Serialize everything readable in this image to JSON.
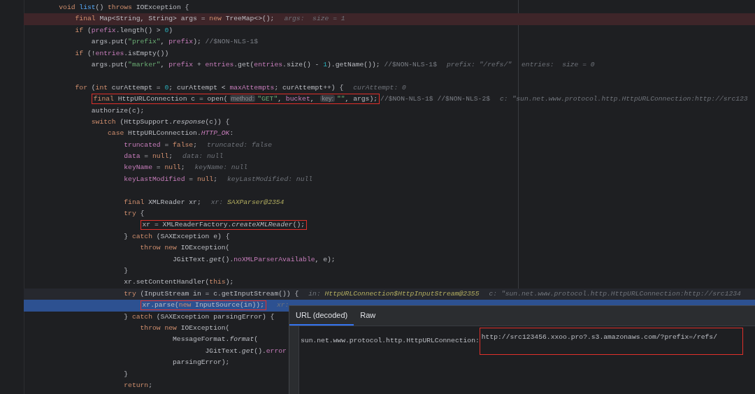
{
  "editor": {
    "lines": [
      {
        "kind": "code",
        "code": [
          {
            "framed": false,
            "tokens": [
              {
                "kind": "keyword",
                "text": "void"
              },
              {
                "kind": "method",
                "text": " list"
              },
              {
                "kind": "plain",
                "text": "() "
              },
              {
                "kind": "keyword",
                "text": "throws"
              },
              {
                "kind": "plain",
                "text": " IOException {"
              }
            ]
          }
        ],
        "children": [
          {
            "kind": "breakpoint",
            "code": [
              {
                "framed": false,
                "tokens": [
                  {
                    "kind": "keyword",
                    "text": "final"
                  },
                  {
                    "kind": "plain",
                    "text": " Map<String, String> args = "
                  },
                  {
                    "kind": "keyword",
                    "text": "new"
                  },
                  {
                    "kind": "plain",
                    "text": " TreeMap<>();"
                  }
                ]
              }
            ],
            "values": [
              {
                "name": "args:",
                "value": " size = 1",
                "kind": "text"
              }
            ]
          },
          {
            "kind": "code",
            "code": [
              {
                "framed": false,
                "tokens": [
                  {
                    "kind": "keyword",
                    "text": "if"
                  },
                  {
                    "kind": "plain",
                    "text": " ("
                  },
                  {
                    "kind": "field",
                    "text": "prefix"
                  },
                  {
                    "kind": "plain",
                    "text": ".length() > "
                  },
                  {
                    "kind": "number",
                    "text": "0"
                  },
                  {
                    "kind": "plain",
                    "text": ")"
                  }
                ]
              }
            ],
            "children": [
              {
                "kind": "code",
                "code": [
                  {
                    "framed": false,
                    "tokens": [
                      {
                        "kind": "plain",
                        "text": "args.put("
                      },
                      {
                        "kind": "string",
                        "text": "\"prefix\""
                      },
                      {
                        "kind": "plain",
                        "text": ", "
                      },
                      {
                        "kind": "field",
                        "text": "prefix"
                      },
                      {
                        "kind": "plain",
                        "text": "); "
                      },
                      {
                        "kind": "comment",
                        "text": "//$NON-NLS-1$"
                      }
                    ]
                  }
                ]
              }
            ]
          },
          {
            "kind": "code",
            "code": [
              {
                "framed": false,
                "tokens": [
                  {
                    "kind": "keyword",
                    "text": "if"
                  },
                  {
                    "kind": "plain",
                    "text": " (!"
                  },
                  {
                    "kind": "field",
                    "text": "entries"
                  },
                  {
                    "kind": "plain",
                    "text": ".isEmpty())"
                  }
                ]
              }
            ],
            "children": [
              {
                "kind": "code",
                "code": [
                  {
                    "framed": false,
                    "tokens": [
                      {
                        "kind": "plain",
                        "text": "args.put("
                      },
                      {
                        "kind": "string",
                        "text": "\"marker\""
                      },
                      {
                        "kind": "plain",
                        "text": ", "
                      },
                      {
                        "kind": "field",
                        "text": "prefix"
                      },
                      {
                        "kind": "plain",
                        "text": " + "
                      },
                      {
                        "kind": "field",
                        "text": "entries"
                      },
                      {
                        "kind": "plain",
                        "text": ".get("
                      },
                      {
                        "kind": "field",
                        "text": "entries"
                      },
                      {
                        "kind": "plain",
                        "text": ".size() - "
                      },
                      {
                        "kind": "number",
                        "text": "1"
                      },
                      {
                        "kind": "plain",
                        "text": ").getName()); "
                      },
                      {
                        "kind": "comment",
                        "text": "//$NON-NLS-1$"
                      }
                    ]
                  }
                ],
                "values": [
                  {
                    "name": "prefix:",
                    "value": "\"/refs/\"",
                    "kind": "text"
                  },
                  {
                    "name": "entries:",
                    "value": " size = 0",
                    "kind": "text"
                  }
                ]
              }
            ]
          },
          {
            "kind": "blank"
          },
          {
            "kind": "code",
            "code": [
              {
                "framed": false,
                "tokens": [
                  {
                    "kind": "keyword",
                    "text": "for"
                  },
                  {
                    "kind": "plain",
                    "text": " ("
                  },
                  {
                    "kind": "keyword",
                    "text": "int"
                  },
                  {
                    "kind": "plain",
                    "text": " curAttempt = "
                  },
                  {
                    "kind": "number",
                    "text": "0"
                  },
                  {
                    "kind": "plain",
                    "text": "; curAttempt < "
                  },
                  {
                    "kind": "field",
                    "text": "maxAttempts"
                  },
                  {
                    "kind": "plain",
                    "text": "; curAttempt++) {"
                  }
                ]
              }
            ],
            "values": [
              {
                "name": "curAttempt:",
                "value": "0",
                "kind": "text"
              }
            ],
            "children": [
              {
                "kind": "code",
                "code": [
                  {
                    "framed": true,
                    "tokens": [
                      {
                        "kind": "keyword",
                        "text": "final"
                      },
                      {
                        "kind": "plain",
                        "text": " HttpURLConnection c = open("
                      },
                      {
                        "kind": "hint",
                        "text": "method:"
                      },
                      {
                        "kind": "string",
                        "text": "\"GET\""
                      },
                      {
                        "kind": "plain",
                        "text": ", "
                      },
                      {
                        "kind": "field",
                        "text": "bucket"
                      },
                      {
                        "kind": "plain",
                        "text": ", "
                      },
                      {
                        "kind": "hint",
                        "text": "key:"
                      },
                      {
                        "kind": "string",
                        "text": "\"\""
                      },
                      {
                        "kind": "plain",
                        "text": ", args);"
                      }
                    ]
                  },
                  {
                    "framed": false,
                    "tokens": [
                      {
                        "kind": "comment",
                        "text": "//$NON-NLS-1$ //$NON-NLS-2$"
                      }
                    ]
                  }
                ],
                "values": [
                  {
                    "name": "c:",
                    "value": "\"sun.net.www.protocol.http.HttpURLConnection:http://src123",
                    "kind": "text"
                  }
                ]
              },
              {
                "kind": "code",
                "code": [
                  {
                    "framed": false,
                    "tokens": [
                      {
                        "kind": "plain",
                        "text": "authorize(c);"
                      }
                    ]
                  }
                ]
              },
              {
                "kind": "code",
                "code": [
                  {
                    "framed": false,
                    "tokens": [
                      {
                        "kind": "keyword",
                        "text": "switch"
                      },
                      {
                        "kind": "plain",
                        "text": " (HttpSupport."
                      },
                      {
                        "kind": "call",
                        "text": "response"
                      },
                      {
                        "kind": "plain",
                        "text": "(c)) {"
                      }
                    ]
                  }
                ],
                "children": [
                  {
                    "kind": "code",
                    "code": [
                      {
                        "framed": false,
                        "tokens": [
                          {
                            "kind": "keyword",
                            "text": "case"
                          },
                          {
                            "kind": "plain",
                            "text": " HttpURLConnection."
                          },
                          {
                            "kind": "constant",
                            "text": "HTTP_OK"
                          },
                          {
                            "kind": "plain",
                            "text": ":"
                          }
                        ]
                      }
                    ],
                    "children": [
                      {
                        "kind": "code",
                        "code": [
                          {
                            "framed": false,
                            "tokens": [
                              {
                                "kind": "field",
                                "text": "truncated"
                              },
                              {
                                "kind": "plain",
                                "text": " = "
                              },
                              {
                                "kind": "keyword",
                                "text": "false"
                              },
                              {
                                "kind": "plain",
                                "text": ";"
                              }
                            ]
                          }
                        ],
                        "values": [
                          {
                            "name": "truncated:",
                            "value": "false",
                            "kind": "text"
                          }
                        ]
                      },
                      {
                        "kind": "code",
                        "code": [
                          {
                            "framed": false,
                            "tokens": [
                              {
                                "kind": "field",
                                "text": "data"
                              },
                              {
                                "kind": "plain",
                                "text": " = "
                              },
                              {
                                "kind": "keyword",
                                "text": "null"
                              },
                              {
                                "kind": "plain",
                                "text": ";"
                              }
                            ]
                          }
                        ],
                        "values": [
                          {
                            "name": "data:",
                            "value": "null",
                            "kind": "text"
                          }
                        ]
                      },
                      {
                        "kind": "code",
                        "code": [
                          {
                            "framed": false,
                            "tokens": [
                              {
                                "kind": "field",
                                "text": "keyName"
                              },
                              {
                                "kind": "plain",
                                "text": " = "
                              },
                              {
                                "kind": "keyword",
                                "text": "null"
                              },
                              {
                                "kind": "plain",
                                "text": ";"
                              }
                            ]
                          }
                        ],
                        "values": [
                          {
                            "name": "keyName:",
                            "value": "null",
                            "kind": "text"
                          }
                        ]
                      },
                      {
                        "kind": "code",
                        "code": [
                          {
                            "framed": false,
                            "tokens": [
                              {
                                "kind": "field",
                                "text": "keyLastModified"
                              },
                              {
                                "kind": "plain",
                                "text": " = "
                              },
                              {
                                "kind": "keyword",
                                "text": "null"
                              },
                              {
                                "kind": "plain",
                                "text": ";"
                              }
                            ]
                          }
                        ],
                        "values": [
                          {
                            "name": "keyLastModified:",
                            "value": "null",
                            "kind": "text"
                          }
                        ]
                      },
                      {
                        "kind": "blank"
                      },
                      {
                        "kind": "code",
                        "code": [
                          {
                            "framed": false,
                            "tokens": [
                              {
                                "kind": "keyword",
                                "text": "final"
                              },
                              {
                                "kind": "plain",
                                "text": " XMLReader xr;"
                              }
                            ]
                          }
                        ],
                        "values": [
                          {
                            "name": "xr:",
                            "value": "SAXParser@2354",
                            "kind": "object"
                          }
                        ]
                      },
                      {
                        "kind": "code",
                        "code": [
                          {
                            "framed": false,
                            "tokens": [
                              {
                                "kind": "keyword",
                                "text": "try"
                              },
                              {
                                "kind": "plain",
                                "text": " {"
                              }
                            ]
                          }
                        ],
                        "children": [
                          {
                            "kind": "code",
                            "code": [
                              {
                                "framed": true,
                                "tokens": [
                                  {
                                    "kind": "plain",
                                    "text": "xr = XMLReaderFactory."
                                  },
                                  {
                                    "kind": "call",
                                    "text": "createXMLReader"
                                  },
                                  {
                                    "kind": "plain",
                                    "text": "();"
                                  }
                                ]
                              }
                            ]
                          }
                        ]
                      },
                      {
                        "kind": "code",
                        "code": [
                          {
                            "framed": false,
                            "tokens": [
                              {
                                "kind": "plain",
                                "text": "} "
                              },
                              {
                                "kind": "keyword",
                                "text": "catch"
                              },
                              {
                                "kind": "plain",
                                "text": " (SAXException e) {"
                              }
                            ]
                          }
                        ],
                        "children": [
                          {
                            "kind": "code",
                            "code": [
                              {
                                "framed": false,
                                "tokens": [
                                  {
                                    "kind": "keyword",
                                    "text": "throw new"
                                  },
                                  {
                                    "kind": "plain",
                                    "text": " IOException("
                                  }
                                ]
                              }
                            ],
                            "continuation": [
                              {
                                "kind": "code",
                                "code": [
                                  {
                                    "framed": false,
                                    "tokens": [
                                      {
                                        "kind": "plain",
                                        "text": "JGitText."
                                      },
                                      {
                                        "kind": "call",
                                        "text": "get"
                                      },
                                      {
                                        "kind": "plain",
                                        "text": "()."
                                      },
                                      {
                                        "kind": "field",
                                        "text": "noXMLParserAvailable"
                                      },
                                      {
                                        "kind": "plain",
                                        "text": ", e);"
                                      }
                                    ]
                                  }
                                ]
                              }
                            ]
                          }
                        ]
                      },
                      {
                        "kind": "code",
                        "code": [
                          {
                            "framed": false,
                            "tokens": [
                              {
                                "kind": "plain",
                                "text": "}"
                              }
                            ]
                          }
                        ]
                      },
                      {
                        "kind": "code",
                        "code": [
                          {
                            "framed": false,
                            "tokens": [
                              {
                                "kind": "plain",
                                "text": "xr.setContentHandler("
                              },
                              {
                                "kind": "keyword",
                                "text": "this"
                              },
                              {
                                "kind": "plain",
                                "text": ");"
                              }
                            ]
                          }
                        ]
                      },
                      {
                        "kind": "caret",
                        "code": [
                          {
                            "framed": false,
                            "tokens": [
                              {
                                "kind": "keyword",
                                "text": "try"
                              },
                              {
                                "kind": "plain",
                                "text": " (InputStream in = c.getInputStream()) {"
                              }
                            ]
                          }
                        ],
                        "values": [
                          {
                            "name": "in:",
                            "value": "HttpURLConnection$HttpInputStream@2355",
                            "kind": "object"
                          },
                          {
                            "name": "c:",
                            "value": "\"sun.net.www.protocol.http.HttpURLConnection:http://src1234",
                            "kind": "text"
                          }
                        ],
                        "children": [
                          {
                            "kind": "execution",
                            "code": [
                              {
                                "framed": true,
                                "tokens": [
                                  {
                                    "kind": "plain",
                                    "text": "xr.parse("
                                  },
                                  {
                                    "kind": "keyword",
                                    "text": "new"
                                  },
                                  {
                                    "kind": "plain",
                                    "text": " InputSource(in));"
                                  }
                                ]
                              }
                            ],
                            "values": [
                              {
                                "name": "xr:"
                              }
                            ]
                          }
                        ]
                      },
                      {
                        "kind": "code",
                        "code": [
                          {
                            "framed": false,
                            "tokens": [
                              {
                                "kind": "plain",
                                "text": "} "
                              },
                              {
                                "kind": "keyword",
                                "text": "catch"
                              },
                              {
                                "kind": "plain",
                                "text": " (SAXException parsingError) {"
                              }
                            ]
                          }
                        ],
                        "children": [
                          {
                            "kind": "code",
                            "code": [
                              {
                                "framed": false,
                                "tokens": [
                                  {
                                    "kind": "keyword",
                                    "text": "throw new"
                                  },
                                  {
                                    "kind": "plain",
                                    "text": " IOException("
                                  }
                                ]
                              }
                            ],
                            "continuation": [
                              {
                                "kind": "code",
                                "code": [
                                  {
                                    "framed": false,
                                    "tokens": [
                                      {
                                        "kind": "plain",
                                        "text": "MessageFormat."
                                      },
                                      {
                                        "kind": "call",
                                        "text": "format"
                                      },
                                      {
                                        "kind": "plain",
                                        "text": "("
                                      }
                                    ]
                                  }
                                ],
                                "continuation": [
                                  {
                                    "kind": "code",
                                    "code": [
                                      {
                                        "framed": false,
                                        "tokens": [
                                          {
                                            "kind": "plain",
                                            "text": "JGitText."
                                          },
                                          {
                                            "kind": "call",
                                            "text": "get"
                                          },
                                          {
                                            "kind": "plain",
                                            "text": "()."
                                          },
                                          {
                                            "kind": "field",
                                            "text": "error"
                                          }
                                        ]
                                      }
                                    ]
                                  }
                                ]
                              },
                              {
                                "kind": "code",
                                "code": [
                                  {
                                    "framed": false,
                                    "tokens": [
                                      {
                                        "kind": "plain",
                                        "text": "parsingError);"
                                      }
                                    ]
                                  }
                                ]
                              }
                            ]
                          }
                        ]
                      },
                      {
                        "kind": "code",
                        "code": [
                          {
                            "framed": false,
                            "tokens": [
                              {
                                "kind": "plain",
                                "text": "}"
                              }
                            ]
                          }
                        ]
                      },
                      {
                        "kind": "code",
                        "code": [
                          {
                            "framed": false,
                            "tokens": [
                              {
                                "kind": "keyword",
                                "text": "return"
                              },
                              {
                                "kind": "plain",
                                "text": ";"
                              }
                            ]
                          }
                        ]
                      }
                    ]
                  }
                ]
              }
            ]
          }
        ]
      }
    ]
  },
  "value_popup": {
    "tabs": [
      {
        "label": "URL (decoded)",
        "selected": true
      },
      {
        "label": "Raw",
        "selected": false
      }
    ],
    "value": [
      {
        "framed": false,
        "text": "sun.net.www.protocol.http.HttpURLConnection:"
      },
      {
        "framed": true,
        "text": "http://src123456.xxoo.pro?.s3.amazonaws.com/?prefix=/refs/"
      }
    ]
  }
}
